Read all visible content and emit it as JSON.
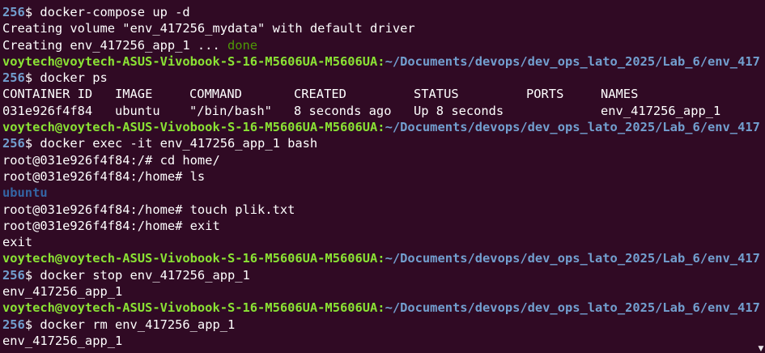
{
  "terminal": {
    "clipped_top": "voytech@voytech-ASUS-Vivobook-S-16-M5606UA-M5606UA:~/Documents/devops/dev_ops_lato_2025/Lab_6/env_417",
    "prompt_user": "voytech@voytech-ASUS-Vivobook-S-16-M5606UA-M5606UA:",
    "prompt_path": "~/Documents/devops/dev_ops_lato_2025/Lab_6/env_417",
    "prompt_cont": "256",
    "lines": [
      {
        "kind": "cmd",
        "text": "$ docker-compose up -d"
      },
      {
        "kind": "out",
        "text": "Creating volume \"env_417256_mydata\" with default driver"
      },
      {
        "kind": "done",
        "text": "Creating env_417256_app_1 ... ",
        "status": "done"
      },
      {
        "kind": "prompt"
      },
      {
        "kind": "cmd",
        "text": "$ docker ps"
      },
      {
        "kind": "table_header",
        "cols": [
          "CONTAINER ID",
          "IMAGE",
          "COMMAND",
          "CREATED",
          "STATUS",
          "PORTS",
          "NAMES"
        ]
      },
      {
        "kind": "table_row",
        "cols": [
          "031e926f4f84",
          "ubuntu",
          "\"/bin/bash\"",
          "8 seconds ago",
          "Up 8 seconds",
          "",
          "env_417256_app_1"
        ]
      },
      {
        "kind": "prompt"
      },
      {
        "kind": "cmd",
        "text": "$ docker exec -it env_417256_app_1 bash"
      },
      {
        "kind": "out",
        "text": "root@031e926f4f84:/# cd home/"
      },
      {
        "kind": "out",
        "text": "root@031e926f4f84:/home# ls"
      },
      {
        "kind": "dir",
        "text": "ubuntu"
      },
      {
        "kind": "out",
        "text": "root@031e926f4f84:/home# touch plik.txt"
      },
      {
        "kind": "out",
        "text": "root@031e926f4f84:/home# exit"
      },
      {
        "kind": "out",
        "text": "exit"
      },
      {
        "kind": "prompt"
      },
      {
        "kind": "cmd",
        "text": "$ docker stop env_417256_app_1"
      },
      {
        "kind": "out",
        "text": "env_417256_app_1"
      },
      {
        "kind": "prompt"
      },
      {
        "kind": "cmd",
        "text": "$ docker rm env_417256_app_1"
      },
      {
        "kind": "out",
        "text": "env_417256_app_1"
      }
    ]
  },
  "colors": {
    "background": "#300a24",
    "prompt_user": "#8ae234",
    "prompt_path": "#729fcf",
    "done": "#4e9a06",
    "directory": "#3465a4"
  },
  "icons": {
    "scroll_arrow": "scroll-down-arrow-icon"
  }
}
